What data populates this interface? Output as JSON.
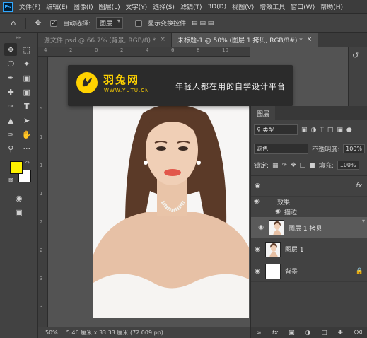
{
  "menubar": {
    "app_icon": "Ps",
    "items": [
      "文件(F)",
      "编辑(E)",
      "图像(I)",
      "图层(L)",
      "文字(Y)",
      "选择(S)",
      "滤镜(T)",
      "3D(D)",
      "视图(V)",
      "增效工具",
      "窗口(W)",
      "帮助(H)"
    ],
    "window_controls": [
      "—",
      "□",
      "✕"
    ]
  },
  "options": {
    "auto_select_label": "自动选择:",
    "auto_select_value": "图层",
    "transform_label": "显示变换控件"
  },
  "tabs": [
    {
      "label": "源文件.psd @ 66.7% (背景, RGB/8) *",
      "close": "×"
    },
    {
      "label": "未标题-1 @ 50% (图层 1 拷贝, RGB/8#) *",
      "close": "×"
    }
  ],
  "ruler": {
    "top": [
      "4",
      "2",
      "0",
      "2",
      "4",
      "6",
      "8",
      "10"
    ],
    "left": [
      "5",
      "1",
      "1",
      "1",
      "2",
      "2",
      "3",
      "3"
    ]
  },
  "banner": {
    "brand": "羽兔网",
    "url": "WWW.YUTU.CN",
    "slogan": "年轻人都在用的自学设计平台"
  },
  "layers_panel": {
    "tab": "图层",
    "filter_value": "类型",
    "blend_mode": "滤色",
    "opacity_label": "不透明度:",
    "opacity_value": "100%",
    "lock_label": "锁定:",
    "fill_label": "填充:",
    "fill_value": "100%",
    "fx_label": "fx",
    "effects_label": "效果",
    "stroke_label": "描边",
    "layers": [
      {
        "name": "图层 1 拷贝",
        "selected": true
      },
      {
        "name": "图层 1",
        "selected": false
      },
      {
        "name": "背景",
        "selected": false
      }
    ],
    "bottom_fx": "fx"
  },
  "status": {
    "zoom": "50%",
    "doc_info": "5.46 厘米 x 33.33 厘米 (72.009 pp)"
  },
  "colors": {
    "foreground": "#fff200",
    "background": "#ffffff",
    "brand_yellow": "#ffd200"
  }
}
